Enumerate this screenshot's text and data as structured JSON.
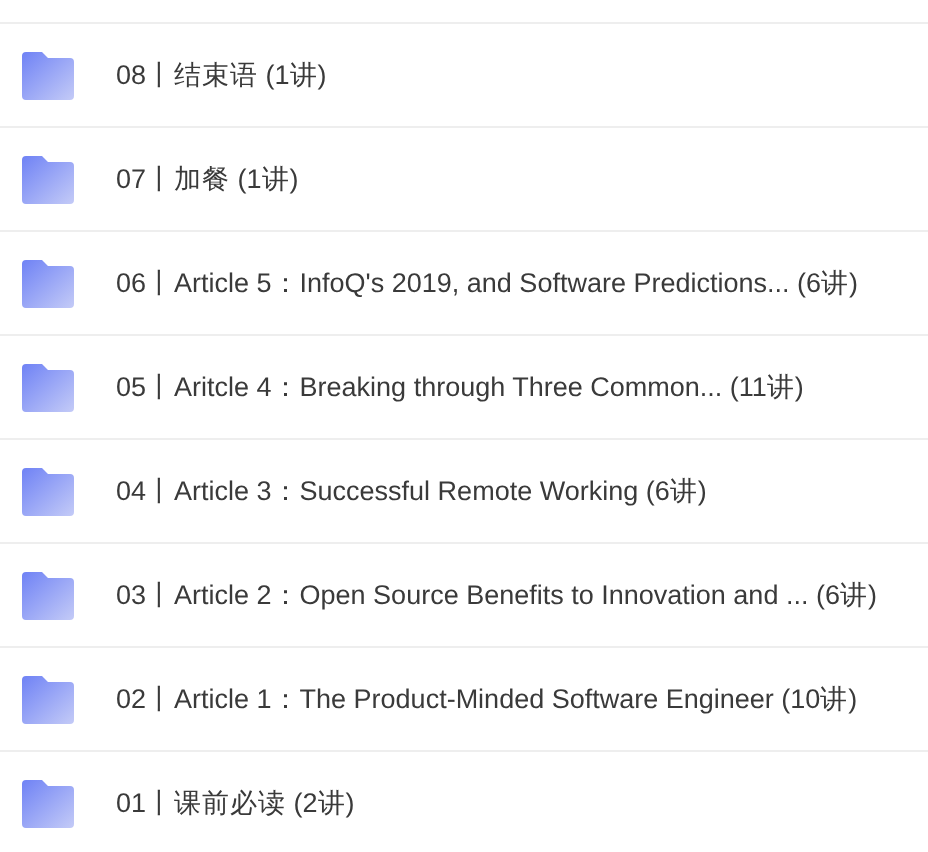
{
  "folders": [
    {
      "title": "08丨结束语 (1讲)"
    },
    {
      "title": "07丨加餐 (1讲)"
    },
    {
      "title": "06丨Article 5：InfoQ's 2019, and Software Predictions... (6讲)"
    },
    {
      "title": "05丨Aritcle 4：Breaking through Three Common... (11讲)"
    },
    {
      "title": "04丨Article 3：Successful Remote Working (6讲)"
    },
    {
      "title": "03丨Article 2：Open Source Benefits to Innovation and ... (6讲)"
    },
    {
      "title": "02丨Article 1：The Product-Minded Software Engineer (10讲)"
    },
    {
      "title": "01丨课前必读 (2讲)"
    }
  ]
}
